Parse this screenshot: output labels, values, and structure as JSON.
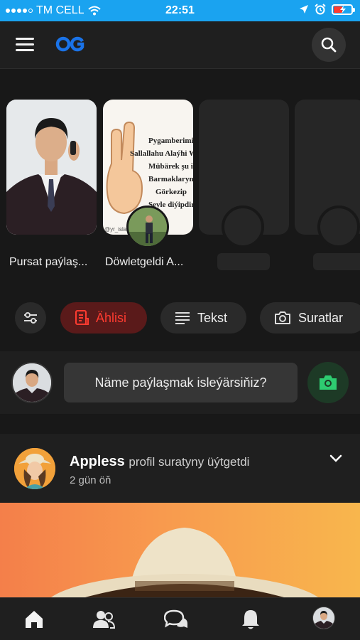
{
  "status_bar": {
    "carrier": "TM CELL",
    "time": "22:51",
    "signal_icon": "signal-dots-icon",
    "wifi_icon": "wifi-icon",
    "location_icon": "location-arrow-icon",
    "alarm_icon": "alarm-clock-icon",
    "battery_icon": "battery-charging-icon",
    "battery_level": 0.5,
    "color": "#1aa3f0"
  },
  "header": {
    "menu_icon": "hamburger-menu-icon",
    "logo": "OG",
    "logo_color": "#1a73e8",
    "search_icon": "search-icon"
  },
  "stories": {
    "items": [
      {
        "label": "Pursat paýlaş...",
        "type": "create",
        "icon": "plus-icon"
      },
      {
        "label": "Döwletgeldi A...",
        "type": "story",
        "watermark": "@yr_islam",
        "text_lines": [
          "Pygamberimiz",
          "Sallallahu Alaýhi We",
          "Mübärek şu ik",
          "Barmaklaryny",
          "Görkezip",
          "Şeyle diýipdir"
        ]
      },
      {
        "label": "",
        "type": "placeholder"
      },
      {
        "label": "",
        "type": "placeholder"
      }
    ]
  },
  "filters": {
    "settings_icon": "sliders-icon",
    "chips": [
      {
        "label": "Ählisi",
        "icon": "document-list-icon",
        "active": true
      },
      {
        "label": "Tekst",
        "icon": "text-lines-icon",
        "active": false
      },
      {
        "label": "Suratlar",
        "icon": "camera-icon",
        "active": false
      }
    ]
  },
  "composer": {
    "placeholder": "Näme paýlaşmak isleýärsiňiz?",
    "photo_icon": "camera-icon",
    "photo_color": "#2ecc71"
  },
  "post": {
    "author": "Appless",
    "action": "profil suratyny üýtgetdi",
    "time": "2 gün öň",
    "menu_icon": "chevron-down-icon"
  },
  "bottom_nav": {
    "items": [
      {
        "icon": "home-icon"
      },
      {
        "icon": "friends-icon"
      },
      {
        "icon": "chat-icon"
      },
      {
        "icon": "bell-icon"
      },
      {
        "icon": "profile-avatar"
      }
    ]
  }
}
